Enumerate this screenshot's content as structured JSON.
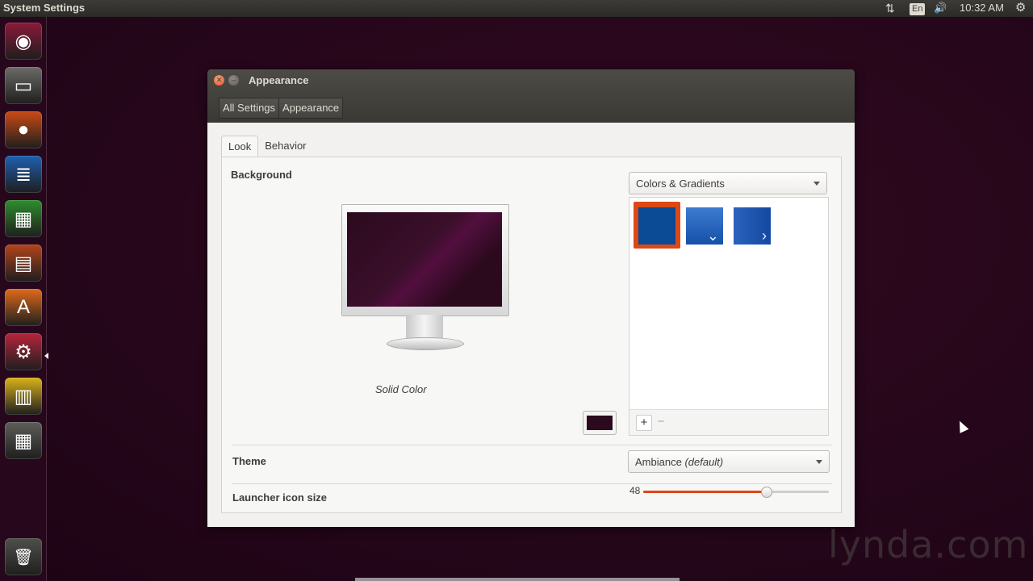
{
  "topbar": {
    "app_title": "System Settings",
    "keyboard_layout": "En",
    "clock": "10:32 AM"
  },
  "launcher": {
    "items": [
      {
        "name": "dash-home",
        "icon": "ubuntu-logo-icon",
        "glyph": "◉",
        "bg": "#8a1a3a"
      },
      {
        "name": "files",
        "icon": "file-cabinet-icon",
        "glyph": "▭",
        "bg": "#6b6b66"
      },
      {
        "name": "firefox",
        "icon": "firefox-icon",
        "glyph": "●",
        "bg": "#c94a14"
      },
      {
        "name": "libreoffice-writer",
        "icon": "writer-document-icon",
        "glyph": "≣",
        "bg": "#1f5fb0"
      },
      {
        "name": "libreoffice-calc",
        "icon": "calc-spreadsheet-icon",
        "glyph": "▦",
        "bg": "#2f8d2f"
      },
      {
        "name": "libreoffice-impress",
        "icon": "impress-presentation-icon",
        "glyph": "▤",
        "bg": "#b3441c"
      },
      {
        "name": "software-center",
        "icon": "software-center-bag-icon",
        "glyph": "A",
        "bg": "#e06a1a"
      },
      {
        "name": "system-settings",
        "icon": "settings-gear-wrench-icon",
        "glyph": "⚙",
        "bg": "#b5253a"
      },
      {
        "name": "archive-manager",
        "icon": "archive-manager-icon",
        "glyph": "▥",
        "bg": "#d9b21a"
      },
      {
        "name": "calculator",
        "icon": "calculator-icon",
        "glyph": "▦",
        "bg": "#5e5e5a"
      }
    ],
    "trash": {
      "name": "trash",
      "icon": "trash-icon",
      "glyph": "🗑",
      "bg": "#4f4f4b"
    }
  },
  "window": {
    "title": "Appearance",
    "breadcrumbs": [
      "All Settings",
      "Appearance"
    ],
    "tabs": [
      "Look",
      "Behavior"
    ],
    "active_tab": "Look",
    "background": {
      "label": "Background",
      "caption": "Solid Color",
      "selected_color": "#2c0a1e",
      "source_dropdown": "Colors & Gradients",
      "swatches": [
        {
          "name": "solid",
          "color": "#0b4a95",
          "selected": true
        },
        {
          "name": "vertical-gradient",
          "color": "#2a68c4",
          "selected": false
        },
        {
          "name": "horizontal-gradient",
          "color": "#1c55b0",
          "selected": false
        }
      ],
      "add_label": "+",
      "remove_label": "−"
    },
    "theme": {
      "label": "Theme",
      "value": "Ambiance",
      "value_suffix": "(default)"
    },
    "launcher_icon_size": {
      "label": "Launcher icon size",
      "value": "48",
      "fraction": 0.66
    }
  },
  "watermark": "lynda.com",
  "colors": {
    "accent": "#dd4814",
    "desktop": "#2c0a1e"
  }
}
